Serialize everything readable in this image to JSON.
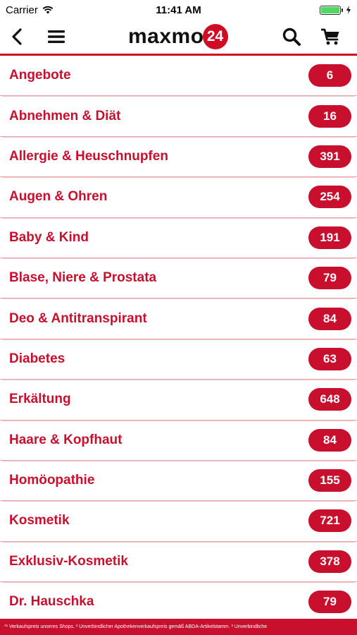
{
  "status": {
    "carrier": "Carrier",
    "time": "11:41 AM",
    "battery_level": 1.0
  },
  "header": {
    "logo_text": "maxmo",
    "logo_badge": "24",
    "icons": [
      "back-icon",
      "menu-icon",
      "search-icon",
      "cart-icon"
    ]
  },
  "colors": {
    "accent": "#c8102e",
    "badge": "#d20b24"
  },
  "categories": [
    {
      "label": "Angebote",
      "count": "6"
    },
    {
      "label": "Abnehmen & Diät",
      "count": "16"
    },
    {
      "label": "Allergie & Heuschnupfen",
      "count": "391"
    },
    {
      "label": "Augen & Ohren",
      "count": "254"
    },
    {
      "label": "Baby & Kind",
      "count": "191"
    },
    {
      "label": "Blase, Niere & Prostata",
      "count": "79"
    },
    {
      "label": "Deo & Antitranspirant",
      "count": "84"
    },
    {
      "label": "Diabetes",
      "count": "63"
    },
    {
      "label": "Erkältung",
      "count": "648"
    },
    {
      "label": "Haare & Kopfhaut",
      "count": "84"
    },
    {
      "label": "Homöopathie",
      "count": "155"
    },
    {
      "label": "Kosmetik",
      "count": "721"
    },
    {
      "label": "Exklusiv-Kosmetik",
      "count": "378"
    },
    {
      "label": "Dr. Hauschka",
      "count": "79"
    }
  ],
  "footer": {
    "text": "*¹ Verkaufspreis unseres Shops. ² Unverbindlicher Apothekenverkaufspreis gemäß ABDA-Artikelstamm. ³ Unverbindliche"
  }
}
